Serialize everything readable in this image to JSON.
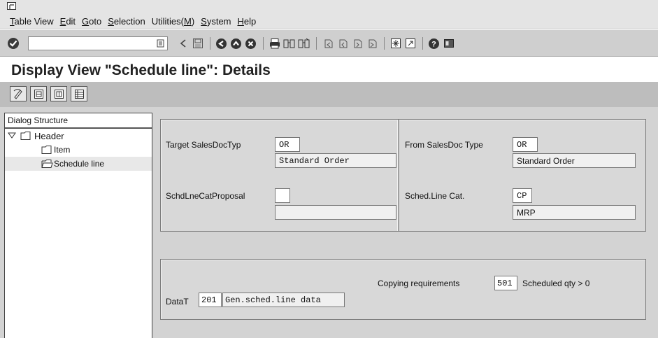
{
  "menubar": {
    "items": [
      {
        "pre": "",
        "ul": "T",
        "post": "able View"
      },
      {
        "pre": "",
        "ul": "E",
        "post": "dit"
      },
      {
        "pre": "",
        "ul": "G",
        "post": "oto"
      },
      {
        "pre": "",
        "ul": "S",
        "post": "election"
      },
      {
        "pre": "Utilities(",
        "ul": "M",
        "post": ")"
      },
      {
        "pre": "",
        "ul": "S",
        "post": "ystem"
      },
      {
        "pre": "",
        "ul": "H",
        "post": "elp"
      }
    ]
  },
  "toolbar": {
    "command_value": "",
    "icons": [
      "back-icon",
      "save-icon",
      "back-green-icon",
      "exit-icon",
      "cancel-icon",
      "print-icon",
      "find-icon",
      "find-next-icon",
      "first-page-icon",
      "prev-page-icon",
      "next-page-icon",
      "last-page-icon",
      "new-session-icon",
      "shortcut-icon",
      "help-icon",
      "layout-icon"
    ]
  },
  "title": "Display View \"Schedule line\": Details",
  "app_toolbar": {
    "icons": [
      "display-change-icon",
      "previous-entry-icon",
      "next-entry-icon",
      "table-view-icon"
    ]
  },
  "dialog_structure": {
    "header": "Dialog Structure",
    "items": [
      {
        "label": "Header",
        "level": 0,
        "expanded": true
      },
      {
        "label": "Item",
        "level": 1
      },
      {
        "label": "Schedule line",
        "level": 1,
        "selected": true
      }
    ]
  },
  "target": {
    "doc_type_label": "Target SalesDocTyp",
    "doc_type_value": "OR",
    "doc_type_desc": "Standard Order",
    "schdl_label": "SchdLneCatProposal",
    "schdl_value": "",
    "schdl_desc": ""
  },
  "source": {
    "doc_type_label": "From SalesDoc Type",
    "doc_type_value": "OR",
    "doc_type_desc": "Standard Order",
    "schdl_label": "Sched.Line Cat.",
    "schdl_value": "CP",
    "schdl_desc": "MRP"
  },
  "copy": {
    "req_label": "Copying requirements",
    "req_value": "501",
    "req_desc": "Scheduled qty > 0",
    "datat_label": "DataT",
    "datat_value": "201",
    "datat_desc": "Gen.sched.line data"
  },
  "colors": {
    "menubar_bg": "#e4e4e4",
    "toolbar_bg": "#cfcfcf",
    "apptoolbar_bg": "#bdbdbd",
    "content_bg": "#d3d3d3"
  }
}
